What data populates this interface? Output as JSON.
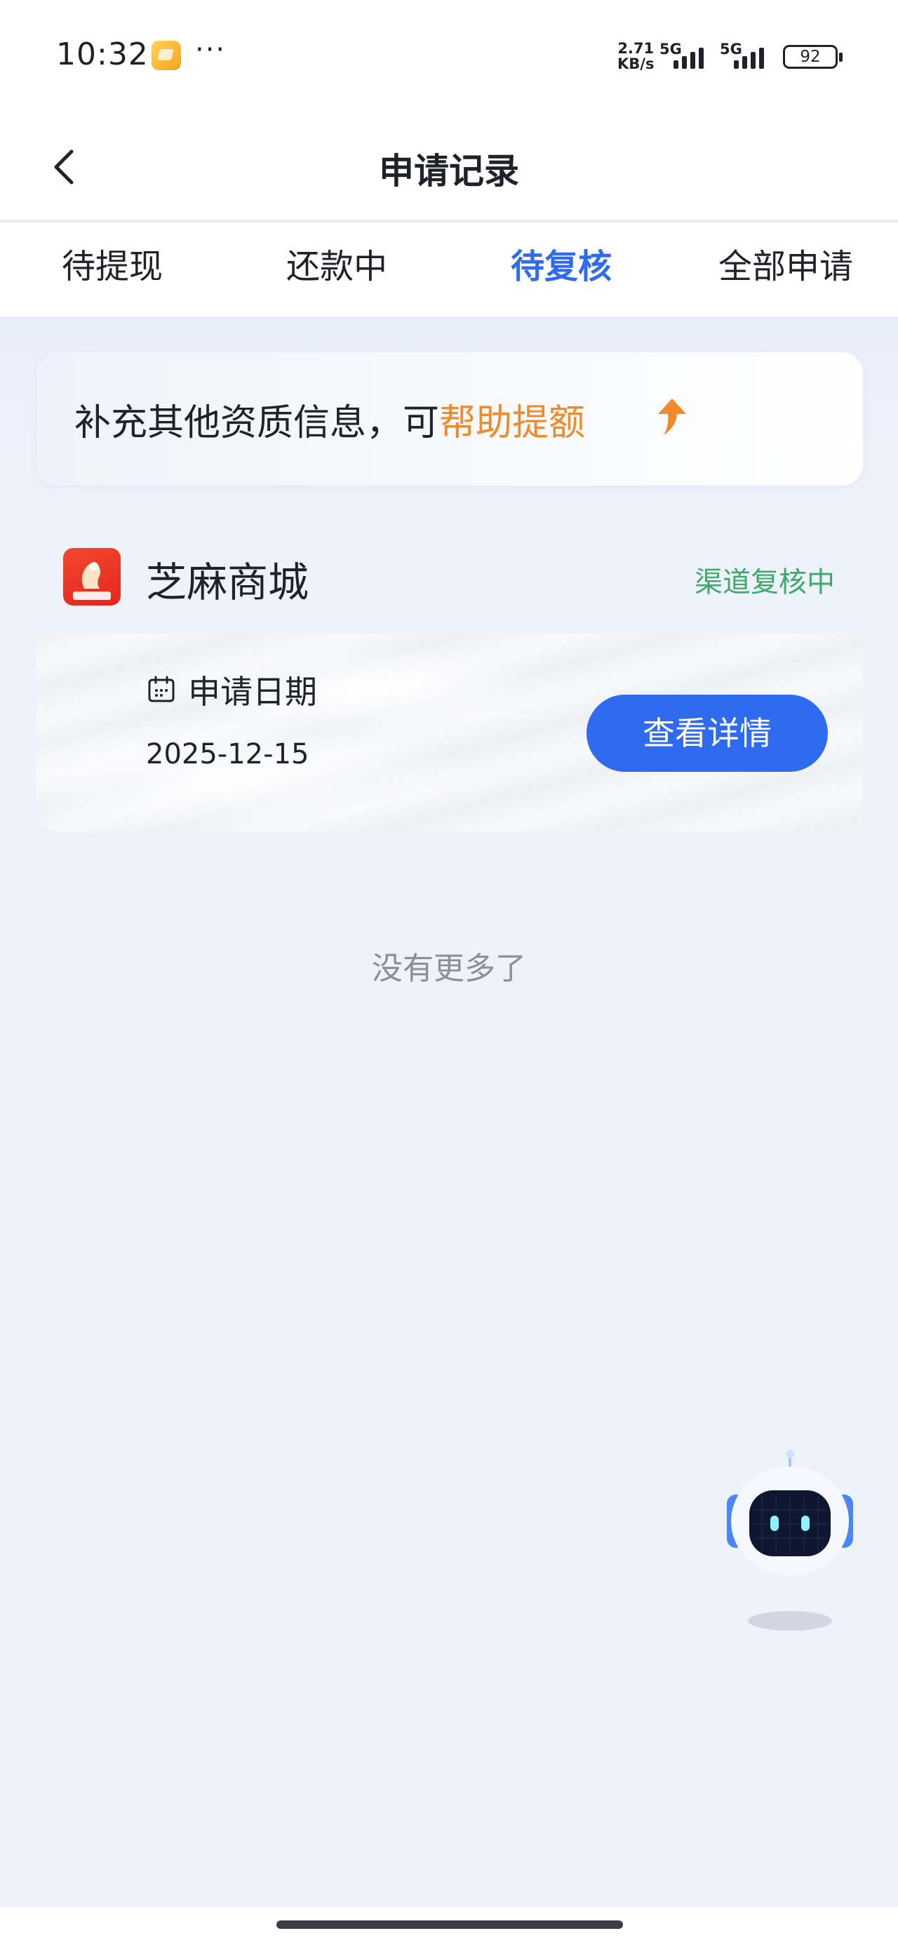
{
  "status_bar": {
    "time": "10:32",
    "more": "···",
    "net_speed_value": "2.71",
    "net_speed_unit": "KB/s",
    "signal_1": "5G",
    "signal_2": "5G",
    "battery": "92"
  },
  "header": {
    "title": "申请记录"
  },
  "tabs": [
    {
      "label": "待提现",
      "active": false
    },
    {
      "label": "还款中",
      "active": false
    },
    {
      "label": "待复核",
      "active": true
    },
    {
      "label": "全部申请",
      "active": false
    }
  ],
  "banner": {
    "text": "补充其他资质信息，可",
    "highlight": "帮助提额"
  },
  "application_card": {
    "app_name": "芝麻商城",
    "logo_text": "芝麻商城",
    "status": "渠道复核中",
    "date_label": "申请日期",
    "date_value": "2025-12-15",
    "button_label": "查看详情"
  },
  "list_footer": "没有更多了",
  "colors": {
    "accent": "#2f6bf0",
    "highlight": "#f08a2c",
    "status_green": "#3daa6a"
  }
}
